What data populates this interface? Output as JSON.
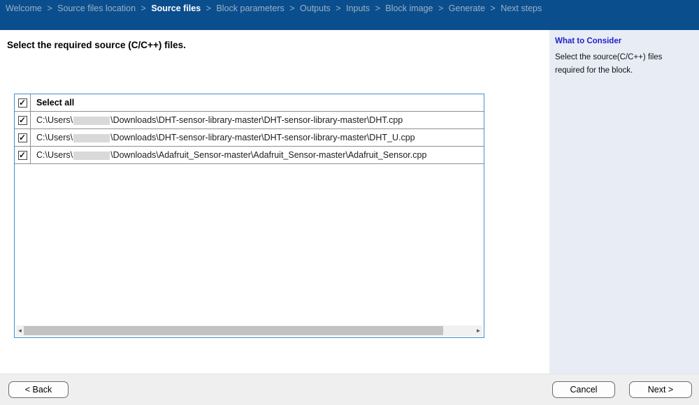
{
  "breadcrumb": {
    "separator": ">",
    "items": [
      {
        "label": "Welcome",
        "active": false
      },
      {
        "label": "Source files location",
        "active": false
      },
      {
        "label": "Source files",
        "active": true
      },
      {
        "label": "Block parameters",
        "active": false
      },
      {
        "label": "Outputs",
        "active": false
      },
      {
        "label": "Inputs",
        "active": false
      },
      {
        "label": "Block image",
        "active": false
      },
      {
        "label": "Generate",
        "active": false
      },
      {
        "label": "Next steps",
        "active": false
      }
    ]
  },
  "main": {
    "heading": "Select the required source (C/C++) files.",
    "table": {
      "select_all_label": "Select all",
      "check_glyph": "✓",
      "rows": [
        {
          "checked": true,
          "prefix": "C:\\Users\\",
          "redacted": true,
          "suffix": "\\Downloads\\DHT-sensor-library-master\\DHT-sensor-library-master\\DHT.cpp"
        },
        {
          "checked": true,
          "prefix": "C:\\Users\\",
          "redacted": true,
          "suffix": "\\Downloads\\DHT-sensor-library-master\\DHT-sensor-library-master\\DHT_U.cpp"
        },
        {
          "checked": true,
          "prefix": "C:\\Users\\",
          "redacted": true,
          "suffix": "\\Downloads\\Adafruit_Sensor-master\\Adafruit_Sensor-master\\Adafruit_Sensor.cpp"
        }
      ],
      "scrollbar": {
        "left_arrow": "◄",
        "right_arrow": "►",
        "thumb_percent": 93
      }
    }
  },
  "sidebar": {
    "title": "What to Consider",
    "body": "Select the source(C/C++) files required for the block."
  },
  "footer": {
    "back_label": "< Back",
    "cancel_label": "Cancel",
    "next_label": "Next >"
  },
  "colors": {
    "header_bg": "#0a4e8e",
    "breadcrumb_inactive": "#9cb1c6",
    "breadcrumb_active": "#ffffff",
    "table_border": "#3d8ed2",
    "sidebar_bg": "#e8edf5",
    "sidebar_title": "#2222cc",
    "footer_bg": "#efefef",
    "redact_box": "#d9d9d9"
  }
}
